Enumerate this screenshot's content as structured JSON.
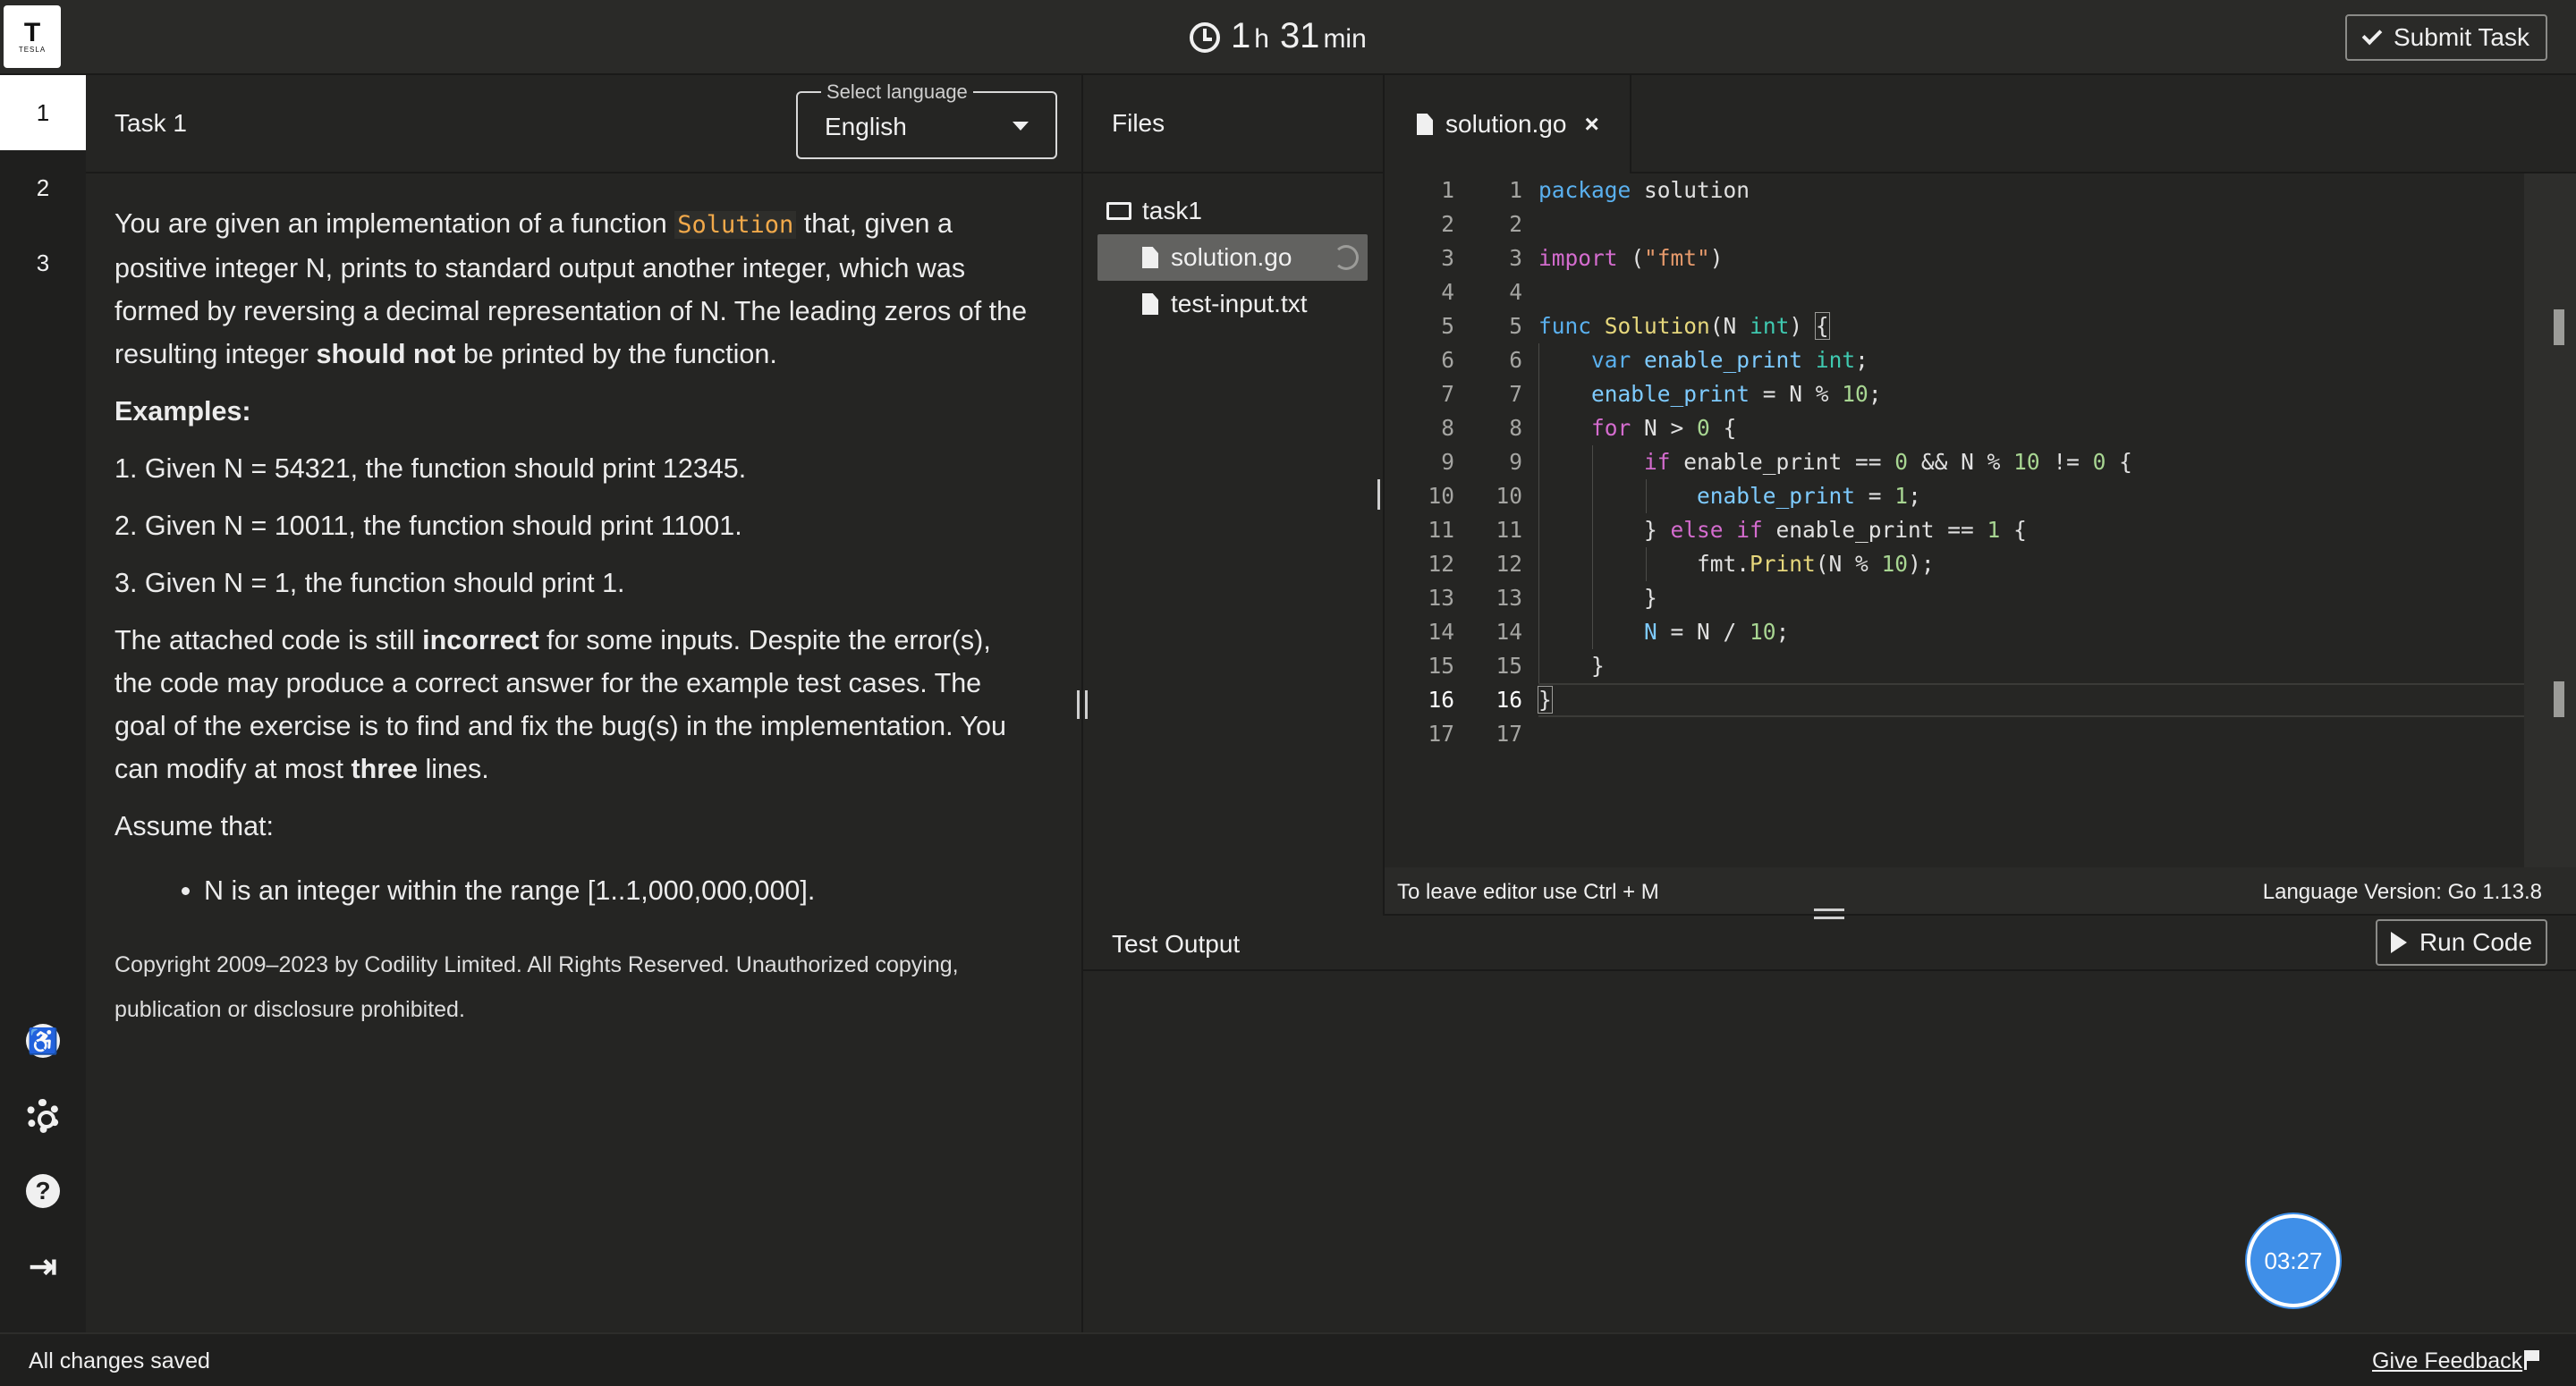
{
  "header": {
    "logo_letter": "T",
    "logo_word": "TESLA",
    "timer_hours": "1",
    "timer_h_unit": "h",
    "timer_minutes": "31",
    "timer_min_unit": "min",
    "submit_label": "Submit Task"
  },
  "nav": {
    "tasks": [
      "1",
      "2",
      "3"
    ],
    "active": "1",
    "icons": [
      "accessibility-icon",
      "gear-icon",
      "help-icon",
      "logout-icon"
    ]
  },
  "task": {
    "title": "Task 1",
    "language_label": "Select language",
    "language_value": "English",
    "intro_before": "You are given an implementation of a function ",
    "intro_code": "Solution",
    "intro_after": " that, given a positive integer N, prints to standard output another integer, which was formed by reversing a decimal representation of N. The leading zeros of the resulting integer ",
    "intro_bold": "should not",
    "intro_end": " be printed by the function.",
    "examples_heading": "Examples:",
    "examples": [
      "1. Given N = 54321, the function should print 12345.",
      "2. Given N = 10011, the function should print 11001.",
      "3. Given N = 1, the function should print 1."
    ],
    "bug_before": "The attached code is still ",
    "bug_bold": "incorrect",
    "bug_mid": " for some inputs. Despite the error(s), the code may produce a correct answer for the example test cases. The goal of the exercise is to find and fix the bug(s) in the implementation. You can modify at most ",
    "bug_bold2": "three",
    "bug_end": " lines.",
    "assume_heading": "Assume that:",
    "assumptions": [
      "N is an integer within the range [1..1,000,000,000]."
    ],
    "copyright": "Copyright 2009–2023 by Codility Limited. All Rights Reserved. Unauthorized copying, publication or disclosure prohibited."
  },
  "files": {
    "heading": "Files",
    "folder": "task1",
    "items": [
      "solution.go",
      "test-input.txt"
    ],
    "selected": "solution.go"
  },
  "editor": {
    "tab_label": "solution.go",
    "tab_close": "×",
    "line_numbers": [
      "1",
      "2",
      "3",
      "4",
      "5",
      "6",
      "7",
      "8",
      "9",
      "10",
      "11",
      "12",
      "13",
      "14",
      "15",
      "16",
      "17"
    ],
    "current_line": "16",
    "code_lines": [
      "package solution",
      "",
      "import (\"fmt\")",
      "",
      "func Solution(N int) {",
      "    var enable_print int;",
      "    enable_print = N % 10;",
      "    for N > 0 {",
      "        if enable_print == 0 && N % 10 != 0 {",
      "            enable_print = 1;",
      "        } else if enable_print == 1 {",
      "            fmt.Print(N % 10);",
      "        }",
      "        N = N / 10;",
      "    }",
      "}",
      ""
    ],
    "footer_hint": "To leave editor use Ctrl + M",
    "language_version": "Language Version: Go 1.13.8"
  },
  "output": {
    "heading": "Test Output",
    "run_label": "Run Code",
    "bubble_time": "03:27"
  },
  "status": {
    "saved": "All changes saved",
    "feedback": "Give Feedback"
  }
}
